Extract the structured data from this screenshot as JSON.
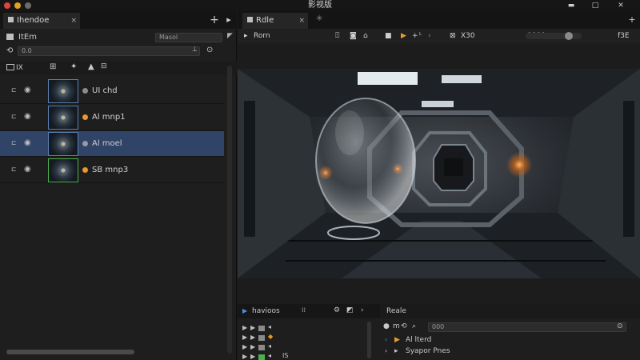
{
  "window": {
    "title": "影视版",
    "minimize_glyph": "▬",
    "maximize_glyph": "□",
    "close_glyph": "✕",
    "traffic_colors": [
      "#e0443e",
      "#dea123",
      "#6b6b6b"
    ]
  },
  "left_panel": {
    "tab_label": "Ihendoe",
    "tab_close": "×",
    "add_glyph": "+",
    "menu_glyph": "▸",
    "header_label": "ItEm",
    "header_field": "Masol",
    "search_value": "0.0",
    "toolbar_label": "IX",
    "layers": [
      {
        "name": "UI chd",
        "dot_color": "#8c8c8c",
        "selected": false,
        "thumb": "blue"
      },
      {
        "name": "Al mnp1",
        "dot_color": "#e79a2c",
        "selected": false,
        "thumb": "blue"
      },
      {
        "name": "Al moel",
        "dot_color": "#9a9a9a",
        "selected": true,
        "thumb": "blue"
      },
      {
        "name": "SB mnp3",
        "dot_color": "#e79a2c",
        "selected": false,
        "thumb": "green"
      }
    ]
  },
  "viewer": {
    "tab_label": "Rdle",
    "tab_close": "×",
    "add_glyph": "+",
    "breadcrumb": "Rorn",
    "resolution": "X30",
    "zoom_value": "0000",
    "zoom_fraction": 0.82,
    "right_label": "f3E"
  },
  "timeline": {
    "tab_label": "havioos",
    "rows": [
      "",
      "",
      "",
      "IS"
    ]
  },
  "properties": {
    "tab_label": "Reale",
    "search_value": "000",
    "items": [
      "Al lterd",
      "Syapor Pnes"
    ]
  }
}
